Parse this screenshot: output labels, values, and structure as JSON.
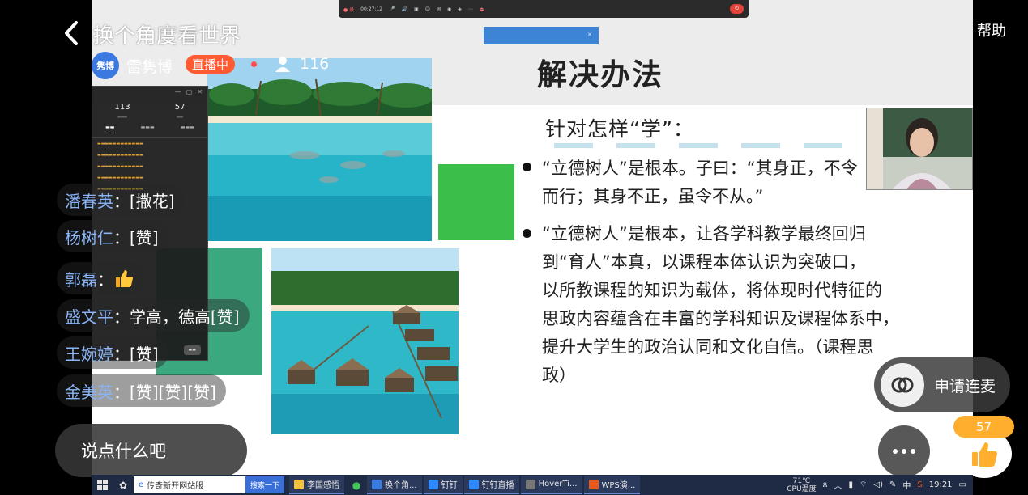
{
  "header": {
    "title": "换个角度看世界",
    "help": "帮助"
  },
  "host": {
    "avatar_text": "隽博",
    "name": "雷隽博",
    "live_badge": "直播中",
    "viewer_count": "116"
  },
  "meeting_toolbar": {
    "items": [
      "00:27:12"
    ],
    "share_notice": ""
  },
  "slide": {
    "title": "解决办法",
    "subtitle": "针对怎样“学”：",
    "bullets": [
      [
        "“立德树人”是根本。子曰：“其身正，不令",
        "而行；其身不正，虽令不从。”"
      ],
      [
        "“立德树人”是根本，让各学科教学最终回归",
        "到“育人”本真，以课程本体认识为突破口，",
        "以所教课程的知识为载体，将体现时代特征的",
        "思政内容蕴含在丰富的学科知识及课程体系中，",
        "提升大学生的政治认同和文化自信。（课程思",
        "政）"
      ]
    ]
  },
  "chat_panel": {
    "stats": [
      {
        "value": "113"
      },
      {
        "value": "57"
      }
    ]
  },
  "comments": [
    {
      "name": "潘春英",
      "content": "[撒花]"
    },
    {
      "name": "杨树仁",
      "content": "[赞]"
    },
    {
      "name": "郭磊",
      "content": ""
    },
    {
      "name": "盛文平",
      "content": "学高，德高[赞]"
    },
    {
      "name": "王婉婷",
      "content": "[赞]"
    },
    {
      "name": "金美英",
      "content": "[赞][赞][赞]"
    }
  ],
  "controls": {
    "comment_placeholder": "说点什么吧",
    "request_connect": "申请连麦",
    "like_count": "57"
  },
  "taskbar": {
    "search_placeholder": "传奇新开网站服",
    "search_button": "搜索一下",
    "apps": [
      {
        "label": "李国感悟",
        "color": "#f2c23a"
      },
      {
        "label": "换个角...",
        "color": "#3a7be0"
      },
      {
        "label": "钉钉",
        "color": "#2e8bff"
      },
      {
        "label": "钉钉直播",
        "color": "#2e8bff"
      },
      {
        "label": "HoverTi...",
        "color": "#777777"
      },
      {
        "label": "WPS演...",
        "color": "#e5591f"
      }
    ],
    "temperature": "71℃",
    "temp_label": "CPU温度",
    "ime": "中",
    "clock": "19:21"
  },
  "colors": {
    "live_badge": "#ff5a32",
    "like": "#ffae2e",
    "comment_name": "#8ab4f6",
    "green_block": "#3cbf4a"
  }
}
